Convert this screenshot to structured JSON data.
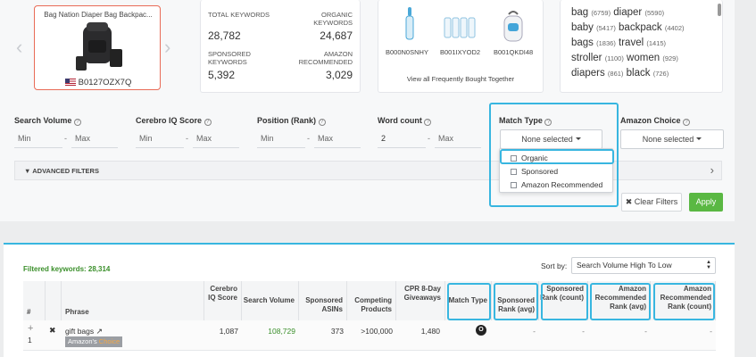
{
  "product": {
    "title": "Bag Nation Diaper Bag Backpac...",
    "asin": "B0127OZX7Q"
  },
  "stats": {
    "total_keywords_label": "TOTAL KEYWORDS",
    "total_keywords_value": "28,782",
    "organic_keywords_label": "ORGANIC KEYWORDS",
    "organic_keywords_value": "24,687",
    "sponsored_keywords_label": "SPONSORED KEYWORDS",
    "sponsored_keywords_value": "5,392",
    "amazon_recommended_label": "AMAZON RECOMMENDED",
    "amazon_recommended_value": "3,029"
  },
  "fbt": {
    "asins": [
      "B000N0SNHY",
      "B001IXYOD2",
      "B001QKDI48"
    ],
    "link": "View all Frequently Bought Together"
  },
  "word_cloud": [
    {
      "word": "bag",
      "count": "(6759)"
    },
    {
      "word": "diaper",
      "count": "(5590)"
    },
    {
      "word": "baby",
      "count": "(5417)"
    },
    {
      "word": "backpack",
      "count": "(4402)"
    },
    {
      "word": "bags",
      "count": "(1836)"
    },
    {
      "word": "travel",
      "count": "(1415)"
    },
    {
      "word": "stroller",
      "count": "(1100)"
    },
    {
      "word": "women",
      "count": "(929)"
    },
    {
      "word": "diapers",
      "count": "(861)"
    },
    {
      "word": "black",
      "count": "(726)"
    }
  ],
  "filters": {
    "search_volume": {
      "label": "Search Volume",
      "min": "Min",
      "max": "Max"
    },
    "cerebro_iq": {
      "label": "Cerebro IQ Score",
      "min": "Min",
      "max": "Max"
    },
    "position": {
      "label": "Position (Rank)",
      "min": "Min",
      "max": "Max"
    },
    "word_count": {
      "label": "Word count",
      "min": "2",
      "max": "Max"
    },
    "match_type": {
      "label": "Match Type",
      "selected": "None selected",
      "options": [
        "Organic",
        "Sponsored",
        "Amazon Recommended"
      ]
    },
    "amazon_choice": {
      "label": "Amazon Choice",
      "selected": "None selected"
    },
    "advanced": "ADVANCED FILTERS",
    "clear": "Clear Filters",
    "apply": "Apply"
  },
  "results": {
    "filtered_label": "Filtered keywords: 28,314",
    "sort_label": "Sort by:",
    "sort_value": "Search Volume High To Low",
    "columns": [
      "#",
      "Phrase",
      "Cerebro IQ Score",
      "Search Volume",
      "Sponsored ASINs",
      "Competing Products",
      "CPR 8-Day Giveaways",
      "Match Type",
      "Sponsored Rank (avg)",
      "Sponsored Rank (count)",
      "Amazon Recommended Rank (avg)",
      "Amazon Recommended Rank (count)"
    ],
    "row": {
      "num": "1",
      "phrase": "gift bags",
      "badge_a": "Amazon's",
      "badge_b": "Choice",
      "iq": "1,087",
      "volume": "108,729",
      "sponsored_asins": "373",
      "competing": ">100,000",
      "cpr": "1,480",
      "match": "O",
      "sp_avg": "-",
      "sp_count": "-",
      "ar_avg": "-",
      "ar_count": "-"
    }
  },
  "colors": {
    "highlight": "#38b6e0",
    "apply": "#5ab843",
    "volume": "#3a8f2a"
  }
}
